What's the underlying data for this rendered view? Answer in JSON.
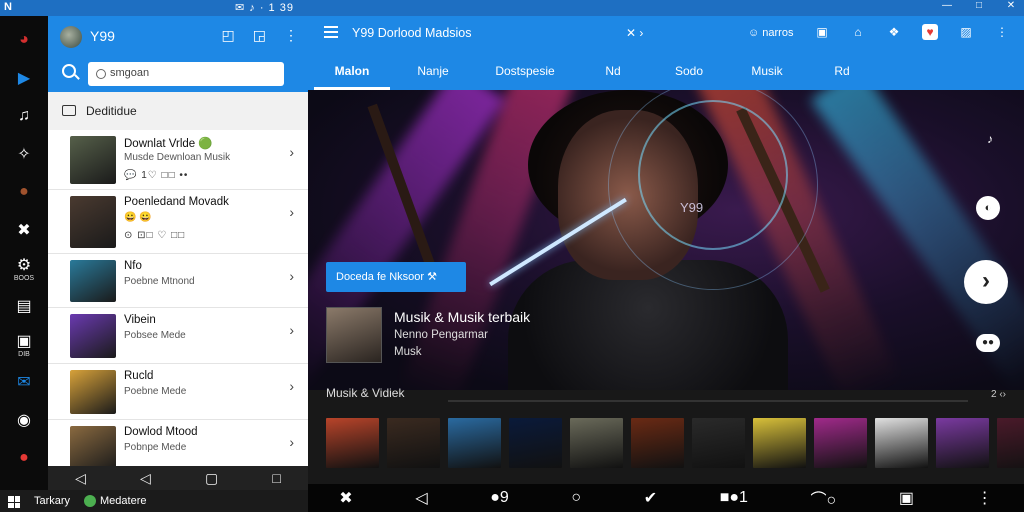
{
  "status": {
    "left": "N",
    "center": "✉ ♪ · 1 39"
  },
  "rail": {
    "items": [
      {
        "name": "app-logo-icon",
        "glyph": "◕",
        "label": "",
        "color": "#d32f2f"
      },
      {
        "name": "play-store-icon",
        "glyph": "▶",
        "label": "",
        "color": "#1e88e5"
      },
      {
        "name": "music-notes-icon",
        "glyph": "♫",
        "label": "",
        "color": "#ffffff"
      },
      {
        "name": "wand-icon",
        "glyph": "✧",
        "label": "",
        "color": "#ffffff"
      },
      {
        "name": "artist-icon",
        "glyph": "●",
        "label": "",
        "color": "#a0522d"
      },
      {
        "name": "close-cross-icon",
        "glyph": "✖",
        "label": "",
        "color": "#ffffff"
      },
      {
        "name": "settings-icon",
        "glyph": "⚙",
        "label": "BOOS",
        "color": "#ffffff"
      },
      {
        "name": "library-icon",
        "glyph": "▤",
        "label": "",
        "color": "#ffffff"
      },
      {
        "name": "chat-icon",
        "glyph": "▣",
        "label": "DIB",
        "color": "#ffffff"
      },
      {
        "name": "mail-icon",
        "glyph": "✉",
        "label": "",
        "color": "#1e88e5"
      },
      {
        "name": "download-icon",
        "glyph": "◉",
        "label": "",
        "color": "#ffffff"
      },
      {
        "name": "radio-icon",
        "glyph": "●",
        "label": "",
        "color": "#e53935"
      }
    ]
  },
  "panel": {
    "title": "Y99",
    "search_placeholder": "smgoan",
    "section": "Deditidue",
    "items": [
      {
        "title": "Downlat Vrlde 🟢",
        "sub": "Musde Dewnloan Musik",
        "meta": "💬 1♡ □□ ••",
        "thumb": "#56604a"
      },
      {
        "title": "Poenledand Movadk",
        "sub": "😀 😀",
        "meta": "⊙ ⊡□ ♡ □□",
        "thumb": "#4a3a30"
      },
      {
        "title": "Nfo",
        "sub": "Poebne Mtnond",
        "meta": "",
        "thumb": "#2a7a9a"
      },
      {
        "title": "Vibein",
        "sub": "Pobsee Mede",
        "meta": "",
        "thumb": "#6a3ab0"
      },
      {
        "title": "Rucld",
        "sub": "Poebne Mede",
        "meta": "",
        "thumb": "#d8a23a"
      },
      {
        "title": "Dowlod Mtood",
        "sub": "Pobnpe Mede",
        "meta": "",
        "thumb": "#8a6a40"
      }
    ]
  },
  "navbar": {
    "back": "◁",
    "back2": "◁",
    "recent": "▢",
    "home": "□"
  },
  "taskbar": {
    "start": "Tarkary",
    "app": "Medatere"
  },
  "main": {
    "app_title": "Y99 Dorlood Madsios",
    "mid": "✕ ›",
    "search_label": "☺ narros",
    "top_icons": [
      "▣",
      "⌂",
      "❖",
      "♥",
      "▨",
      "⋮"
    ],
    "tabs": [
      "Malon",
      "Nanje",
      "Dostspesie",
      "Nd",
      "Sodo",
      "Musik",
      "Rd"
    ],
    "active_tab": 0,
    "hero_word": "Y99",
    "hero_button": "Doceda fe Nksoor  ⚒",
    "hero_card_title": "Musik & Musik terbaik",
    "hero_card_sub1": "Nenno Pengarmar",
    "hero_card_sub2": "Musk",
    "right_buttons": [
      "♪",
      "◐",
      "›",
      "●●"
    ],
    "row_title": "Musik & Vidiek",
    "row_right": "2 ‹›",
    "posters": [
      "#b8442a",
      "#3a2a20",
      "#2a6aa0",
      "#0a1a3a",
      "#6a6a5a",
      "#6a2a14",
      "#2a2a2a",
      "#d8c03a",
      "#a02a8a",
      "#e0e0e0",
      "#7a3aa0",
      "#4a1a2a",
      "#a0202a"
    ],
    "bottom": [
      "✖",
      "◁",
      "●9",
      "○",
      "✔",
      "■●1",
      "⌒○",
      "▣",
      "⋮"
    ]
  }
}
